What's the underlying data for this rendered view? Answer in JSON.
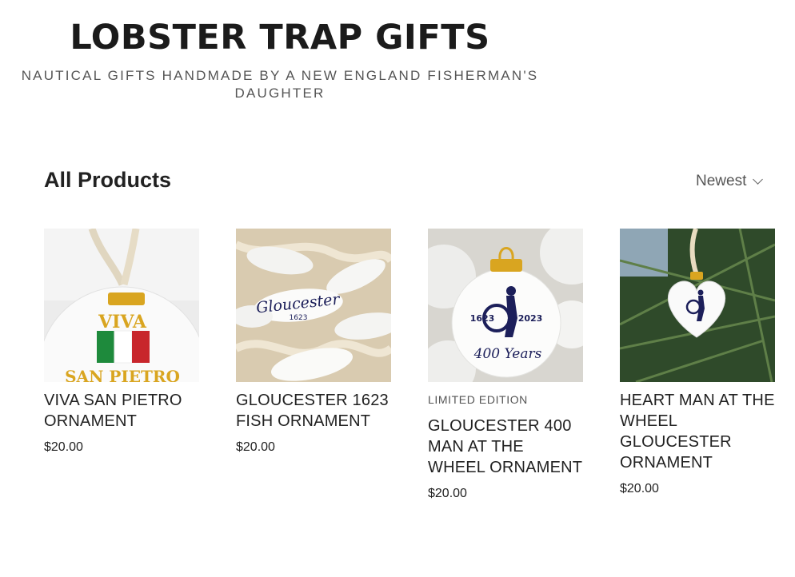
{
  "header": {
    "title": "LOBSTER TRAP GIFTS",
    "tagline": "NAUTICAL GIFTS HANDMADE BY A NEW ENGLAND FISHERMAN'S DAUGHTER"
  },
  "catalog": {
    "heading": "All Products",
    "sort_label": "Newest",
    "sort_icon": "chevron-down-icon"
  },
  "products": [
    {
      "name": "VIVA SAN PIETRO ORNAMENT",
      "price": "$20.00",
      "badge": "",
      "image_text": {
        "line1": "VIVA",
        "line2": "SAN PIETRO"
      }
    },
    {
      "name": "GLOUCESTER 1623 FISH ORNAMENT",
      "price": "$20.00",
      "badge": "",
      "image_text": {
        "line1": "Gloucester",
        "line2": "1623"
      }
    },
    {
      "name": "GLOUCESTER 400 MAN AT THE WHEEL ORNAMENT",
      "price": "$20.00",
      "badge": "LIMITED EDITION",
      "image_text": {
        "line1": "1623",
        "line2": "2023",
        "line3": "400 Years"
      }
    },
    {
      "name": "HEART MAN AT THE WHEEL GLOUCESTER ORNAMENT",
      "price": "$20.00",
      "badge": "",
      "image_text": {}
    }
  ],
  "colors": {
    "text": "#222222",
    "muted": "#555555",
    "gold": "#d9a520",
    "navy": "#1c1f5a",
    "italy_green": "#1e8a3c",
    "italy_red": "#c8262c"
  }
}
